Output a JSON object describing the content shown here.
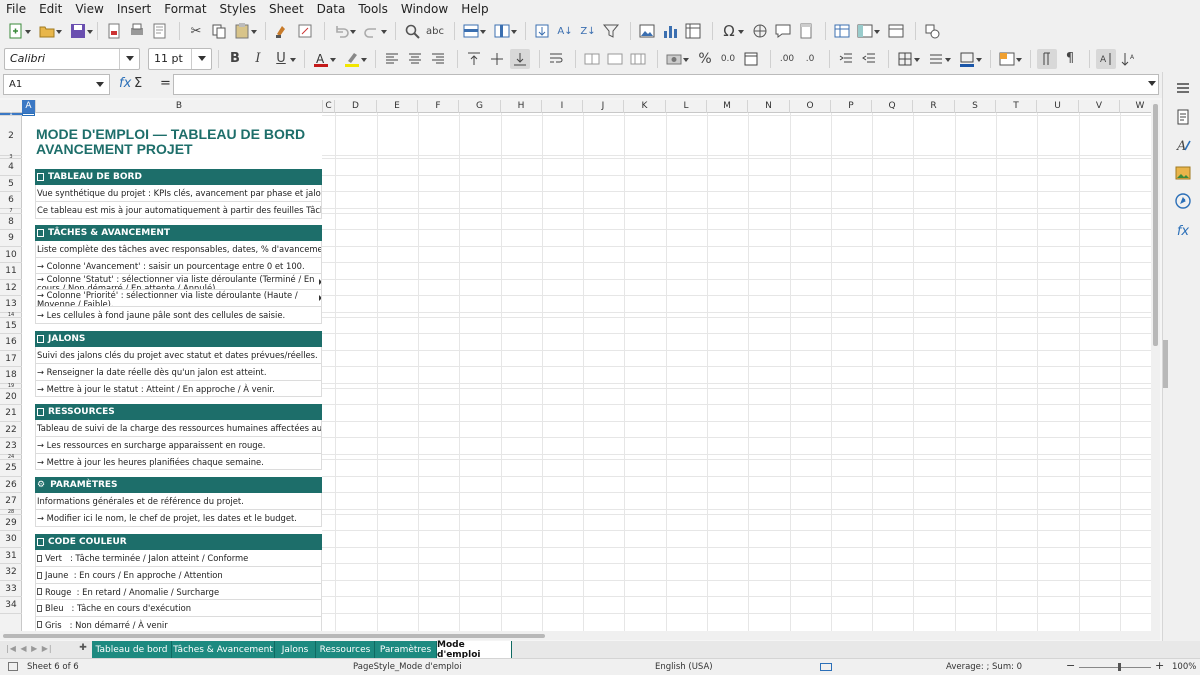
{
  "menu": [
    "File",
    "Edit",
    "View",
    "Insert",
    "Format",
    "Styles",
    "Sheet",
    "Data",
    "Tools",
    "Window",
    "Help"
  ],
  "toolbar": {
    "font_name": "Calibri",
    "font_size": "11 pt",
    "bold": "B",
    "italic": "I",
    "underline": "U",
    "percent": "%",
    "decimal": "0.0",
    "add_decimal": ".00",
    "del_decimal": ".0"
  },
  "formula_bar": {
    "cell_ref": "A1",
    "fx": "fx",
    "sum": "Σ",
    "equals": "=",
    "content": ""
  },
  "columns": [
    "A",
    "B",
    "C",
    "D",
    "E",
    "F",
    "G",
    "H",
    "I",
    "J",
    "K",
    "L",
    "M",
    "N",
    "O",
    "P",
    "Q",
    "R",
    "S",
    "T",
    "U",
    "V",
    "W"
  ],
  "rows": [
    "1",
    "2",
    "3",
    "4",
    "5",
    "6",
    "7",
    "8",
    "9",
    "10",
    "11",
    "12",
    "13",
    "14",
    "15",
    "16",
    "17",
    "18",
    "19",
    "20",
    "21",
    "22",
    "23",
    "24",
    "25",
    "26",
    "27",
    "28",
    "29",
    "30",
    "31",
    "32",
    "33",
    "34"
  ],
  "sheet": {
    "title_line1": "MODE D'EMPLOI — TABLEAU DE BORD",
    "title_line2": "AVANCEMENT PROJET",
    "sections": [
      {
        "header": "TABLEAU DE BORD",
        "lines": [
          "Vue synthétique du projet : KPIs clés, avancement par phase et jalons.",
          "Ce tableau est mis à jour automatiquement à partir des feuilles Tâches et Jalons."
        ]
      },
      {
        "header": "TÂCHES & AVANCEMENT",
        "lines": [
          "Liste complète des tâches avec responsables, dates, % d'avancement et statuts.",
          "→ Colonne 'Avancement' : saisir un pourcentage entre 0 et 100.",
          "→ Colonne 'Statut' : sélectionner via liste déroulante (Terminé / En cours / Non démarré / En attente / Annulé).",
          "→ Colonne 'Priorité' : sélectionner via liste déroulante (Haute / Moyenne / Faible).",
          "→ Les cellules à fond jaune pâle sont des cellules de saisie."
        ]
      },
      {
        "header": "JALONS",
        "lines": [
          "Suivi des jalons clés du projet avec statut et dates prévues/réelles.",
          "→ Renseigner la date réelle dès qu'un jalon est atteint.",
          "→ Mettre à jour le statut : Atteint / En approche / À venir."
        ]
      },
      {
        "header": "RESSOURCES",
        "lines": [
          "Tableau de suivi de la charge des ressources humaines affectées au projet.",
          "→ Les ressources en surcharge apparaissent en rouge.",
          "→ Mettre à jour les heures planifiées chaque semaine."
        ]
      },
      {
        "header": "PARAMÈTRES",
        "lines": [
          "Informations générales et de référence du projet.",
          "→ Modifier ici le nom, le chef de projet, les dates et le budget."
        ]
      },
      {
        "header": "CODE COULEUR",
        "lines": [
          "Vert   : Tâche terminée / Jalon atteint / Conforme",
          "Jaune  : En cours / En approche / Attention",
          "Rouge  : En retard / Anomalie / Surcharge",
          "Bleu   : Tâche en cours d'exécution",
          "Gris   : Non démarré / À venir"
        ]
      }
    ]
  },
  "tabs": [
    "Tableau de bord",
    "Tâches & Avancement",
    "Jalons",
    "Ressources",
    "Paramètres",
    "Mode d'emploi"
  ],
  "active_tab": "Mode d'emploi",
  "status": {
    "sheet": "Sheet 6 of 6",
    "page_style": "PageStyle_Mode d'emploi",
    "language": "English (USA)",
    "summary": "Average: ; Sum: 0",
    "zoom": "100%"
  },
  "colors": {
    "section_header": "#1d6e6a",
    "tab": "#1d8a80",
    "selection": "#3b78c4"
  }
}
